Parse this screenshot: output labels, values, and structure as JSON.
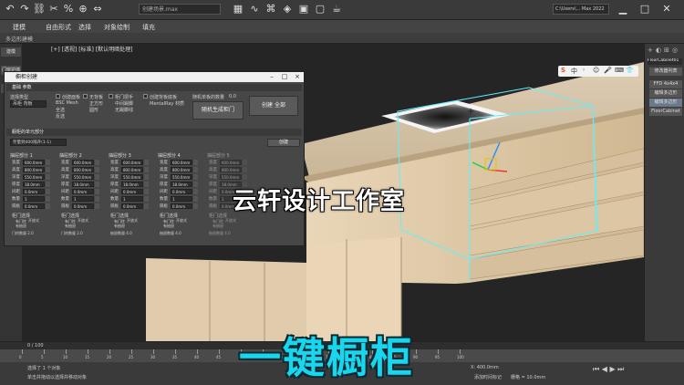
{
  "app": {
    "title": "创建场景.max",
    "workspace": "C:\\Users\\... Max 2022"
  },
  "menubar": [
    "建模",
    "自由形式",
    "选择",
    "对象绘制",
    "填充"
  ],
  "ribbon": [
    "多边形建模"
  ],
  "left_strip": [
    "建模",
    "门窗护墙板",
    "工具",
    "建模库"
  ],
  "viewport_label": "[+] [透视] [标准] [默认明暗处理]",
  "dialog": {
    "title": "橱柜创建",
    "close": "×",
    "section1": "基础 参数",
    "select_type_label": "选择类型",
    "select_type_value": "吊柜 背板",
    "opts_a": [
      "创建面板",
      "BSC Mesh",
      "全选",
      "反选"
    ],
    "opts_b": [
      "无背板",
      "正方形",
      "圆形"
    ],
    "opts_c": [
      "柜门把手",
      "中间踢脚",
      "无踢脚线"
    ],
    "opts_d": [
      "创建背板底板",
      "MentalRay 材质"
    ],
    "count_label": "随机单板的数量",
    "count_value": "0.0",
    "btn_random": "随机生成柜门",
    "btn_create": "创建 全部",
    "section2": "橱柜的单元部分",
    "create_btn": "创建",
    "dropdown": "存量到400隔开(1-1)",
    "columns": [
      {
        "head": "抽屉部分 1",
        "rows": [
          [
            "宽度",
            "600.0mm"
          ],
          [
            "高度",
            "800.0mm"
          ],
          [
            "深度",
            "550.0mm"
          ],
          [
            "厚度",
            "18.0mm"
          ],
          [
            "间距",
            "0.0mm"
          ],
          [
            "数量",
            "1"
          ],
          [
            "隔板",
            "0.0mm"
          ]
        ],
        "door": "柜门选择",
        "extra": [
          "开放式",
          "有门柱",
          "有抽屉"
        ],
        "foot": "门的数量 2.0"
      },
      {
        "head": "抽屉部分 2",
        "rows": [
          [
            "宽度",
            "600.0mm"
          ],
          [
            "高度",
            "800.0mm"
          ],
          [
            "深度",
            "550.0mm"
          ],
          [
            "厚度",
            "18.0mm"
          ],
          [
            "间距",
            "0.0mm"
          ],
          [
            "数量",
            "1"
          ],
          [
            "隔板",
            "0.0mm"
          ]
        ],
        "door": "柜门选择",
        "extra": [
          "开放式",
          "有门柱",
          "有抽屉"
        ],
        "foot": "门的数量 2.0"
      },
      {
        "head": "抽屉部分 3",
        "rows": [
          [
            "宽度",
            "600.0mm"
          ],
          [
            "高度",
            "800.0mm"
          ],
          [
            "深度",
            "550.0mm"
          ],
          [
            "厚度",
            "18.0mm"
          ],
          [
            "间距",
            "0.0mm"
          ],
          [
            "数量",
            "1"
          ],
          [
            "隔板",
            "0.0mm"
          ]
        ],
        "door": "柜门选择",
        "extra": [
          "开放式",
          "有门柱",
          "有抽屉"
        ],
        "foot": "抽屉数量 4.0"
      },
      {
        "head": "抽屉部分 4",
        "rows": [
          [
            "宽度",
            "600.0mm"
          ],
          [
            "高度",
            "800.0mm"
          ],
          [
            "深度",
            "550.0mm"
          ],
          [
            "厚度",
            "18.0mm"
          ],
          [
            "间距",
            "0.0mm"
          ],
          [
            "数量",
            "1"
          ],
          [
            "隔板",
            "0.0mm"
          ]
        ],
        "door": "柜门选择",
        "extra": [
          "开放式",
          "有门柱",
          "有抽屉"
        ],
        "foot": "抽屉数量 4.0"
      },
      {
        "head": "抽屉部分 5",
        "rows": [
          [
            "宽度",
            "600.0mm"
          ],
          [
            "高度",
            "800.0mm"
          ],
          [
            "深度",
            "550.0mm"
          ],
          [
            "厚度",
            "18.0mm"
          ],
          [
            "间距",
            "0.0mm"
          ],
          [
            "数量",
            "1"
          ],
          [
            "隔板",
            "0.0mm"
          ]
        ],
        "door": "柜门选择",
        "extra": [
          "开放式",
          "有门柱",
          "有抽屉"
        ],
        "foot": "抽屉数量 4.0"
      }
    ]
  },
  "right_panel": {
    "name": "FloorCabinet01",
    "items": [
      "修改器列表",
      "FFD 4x4x4",
      "编辑多边形",
      "编辑多边形",
      "FloorCabinet"
    ]
  },
  "timeline": {
    "frame": "0 / 100",
    "ticks": [
      "0",
      "5",
      "10",
      "15",
      "20",
      "25",
      "30",
      "35",
      "40",
      "45",
      "50",
      "55",
      "60",
      "65",
      "70",
      "75",
      "80",
      "85",
      "90",
      "95",
      "100"
    ]
  },
  "status": {
    "selection": "选择了 1 个对象",
    "hint": "单击并拖动以选择并移动对象",
    "x": "X: 400.0mm",
    "grid": "栅格 = 10.0mm",
    "addtime": "添加时间标记"
  },
  "watermark": "云轩设计工作室",
  "caption": "一键橱柜",
  "colors": {
    "countertop": "#d9c7ac",
    "cabinet": "#e6d2b4",
    "caption": "#19d6ef",
    "selection": "#5ff0ff"
  }
}
